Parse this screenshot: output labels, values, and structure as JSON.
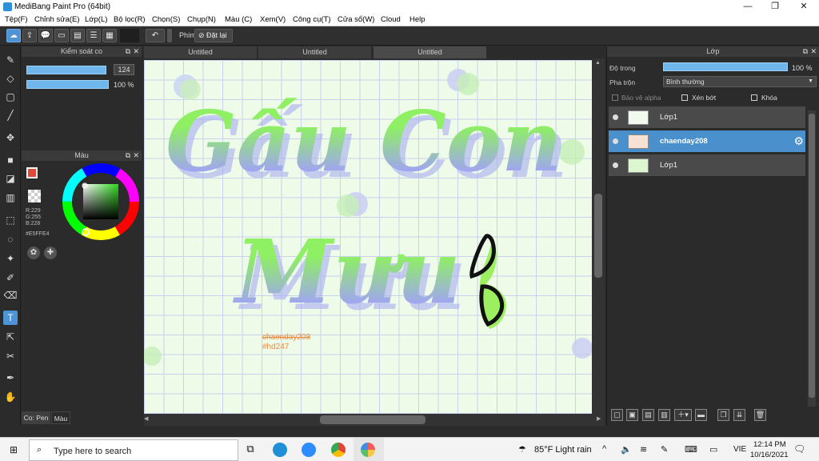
{
  "window": {
    "title": "MediBang Paint Pro (64bit)"
  },
  "menu": [
    "Tệp(F)",
    "Chỉnh sửa(E)",
    "Lớp(L)",
    "Bộ lọc(R)",
    "Chọn(S)",
    "Chụp(N)",
    "Màu (C)",
    "Xem(V)",
    "Công cụ(T)",
    "Cửa sổ(W)",
    "Cloud",
    "Help"
  ],
  "toolbar": {
    "shortcut_label": "Phím",
    "reset_label": "Đặt lại"
  },
  "brush_panel": {
    "title": "Kiểm soát co",
    "size_value": "124",
    "opacity_value": "100 %",
    "size_fraction": 0.97,
    "opacity_fraction": 1.0
  },
  "color_panel": {
    "title": "Màu",
    "rgb_r": "R:229",
    "rgb_g": "G:255",
    "rgb_b": "B:228",
    "hex": "#E5FFE4",
    "current_color": "#e04a3a"
  },
  "left_tabs": [
    "Co: Pen",
    "Màu"
  ],
  "doc_tabs": [
    "Untitled",
    "Untitled",
    "Untitled"
  ],
  "canvas": {
    "line1": "Gấu Con",
    "line2": "Mưu",
    "watermark1": "chaenday208",
    "watermark2": "#hd247",
    "colors": {
      "green": "#8ef062",
      "purple": "#9aa0f0",
      "background": "#eefbe9"
    }
  },
  "layer_panel": {
    "title": "Lớp",
    "opacity_label": "Độ trong",
    "opacity_value": "100 %",
    "blend_label": "Pha trộn",
    "blend_value": "Bình thường",
    "protect_alpha": "Bảo vệ alpha",
    "clipping": "Xén bớt",
    "lock": "Khóa",
    "layers": [
      {
        "name": "Lớp1",
        "selected": false
      },
      {
        "name": "chaenday208",
        "selected": true
      },
      {
        "name": "Lớp1",
        "selected": false
      }
    ]
  },
  "taskbar": {
    "search_placeholder": "Type here to search",
    "weather": "85°F  Light rain",
    "lang": "VIE",
    "time": "12:14 PM",
    "date": "10/16/2021"
  }
}
